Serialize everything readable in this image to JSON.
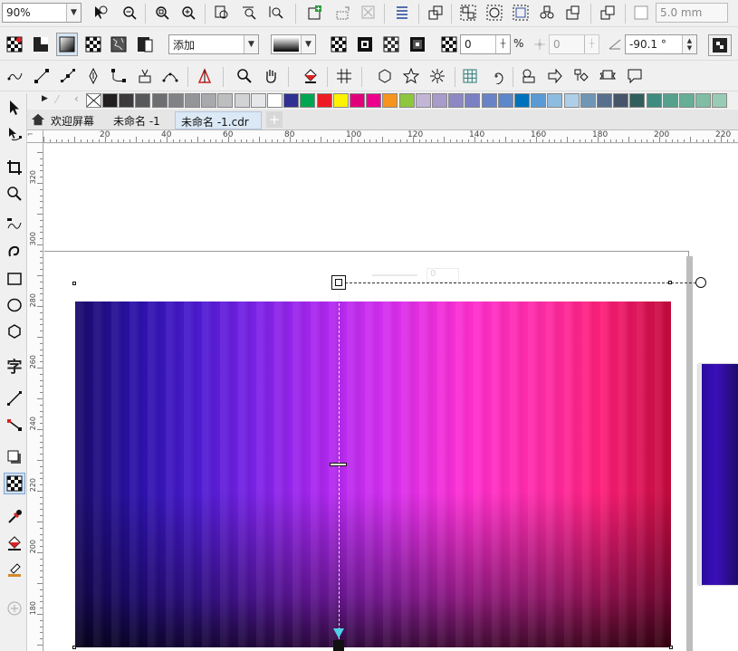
{
  "toolbar": {
    "zoom_value": "90%",
    "nudge_value": "5.0 mm"
  },
  "property_bar": {
    "merge_mode": "添加",
    "transparency_value": "0",
    "percent_sign": "%",
    "angle_field_value": "0",
    "rotation_value": "-90.1 °"
  },
  "tabs": [
    {
      "label": "欢迎屏幕"
    },
    {
      "label": "未命名 -1"
    },
    {
      "label": "未命名 -1.cdr"
    }
  ],
  "ruler_top": [
    "20",
    "40",
    "60",
    "80",
    "100",
    "120",
    "140",
    "160",
    "180",
    "200",
    "220"
  ],
  "ruler_left": [
    "320",
    "300",
    "280",
    "260",
    "240",
    "220",
    "200",
    "180"
  ],
  "palette": [
    "#231f20",
    "#3d3a3b",
    "#58595b",
    "#6d6e71",
    "#808285",
    "#939598",
    "#a7a9ac",
    "#bcbec0",
    "#d1d3d4",
    "#e6e7e8",
    "#ffffff",
    "#2e3192",
    "#00a651",
    "#ed1c24",
    "#fff200",
    "#e2007a",
    "#ec008c",
    "#f7941d",
    "#8dc63f",
    "#c2b5d6",
    "#a89ccb",
    "#8e88c4",
    "#7b7fc3",
    "#6a82c7",
    "#5c87c9",
    "#0072bc",
    "#5b9bd5",
    "#8dbce0",
    "#aecfe7",
    "#7096b6",
    "#58708d",
    "#47556b",
    "#2f5e5c",
    "#3d8c7f",
    "#55a18e",
    "#66ae96",
    "#7fbea4",
    "#99ccb5"
  ],
  "canvas": {
    "transparency_widget_value": "0"
  }
}
